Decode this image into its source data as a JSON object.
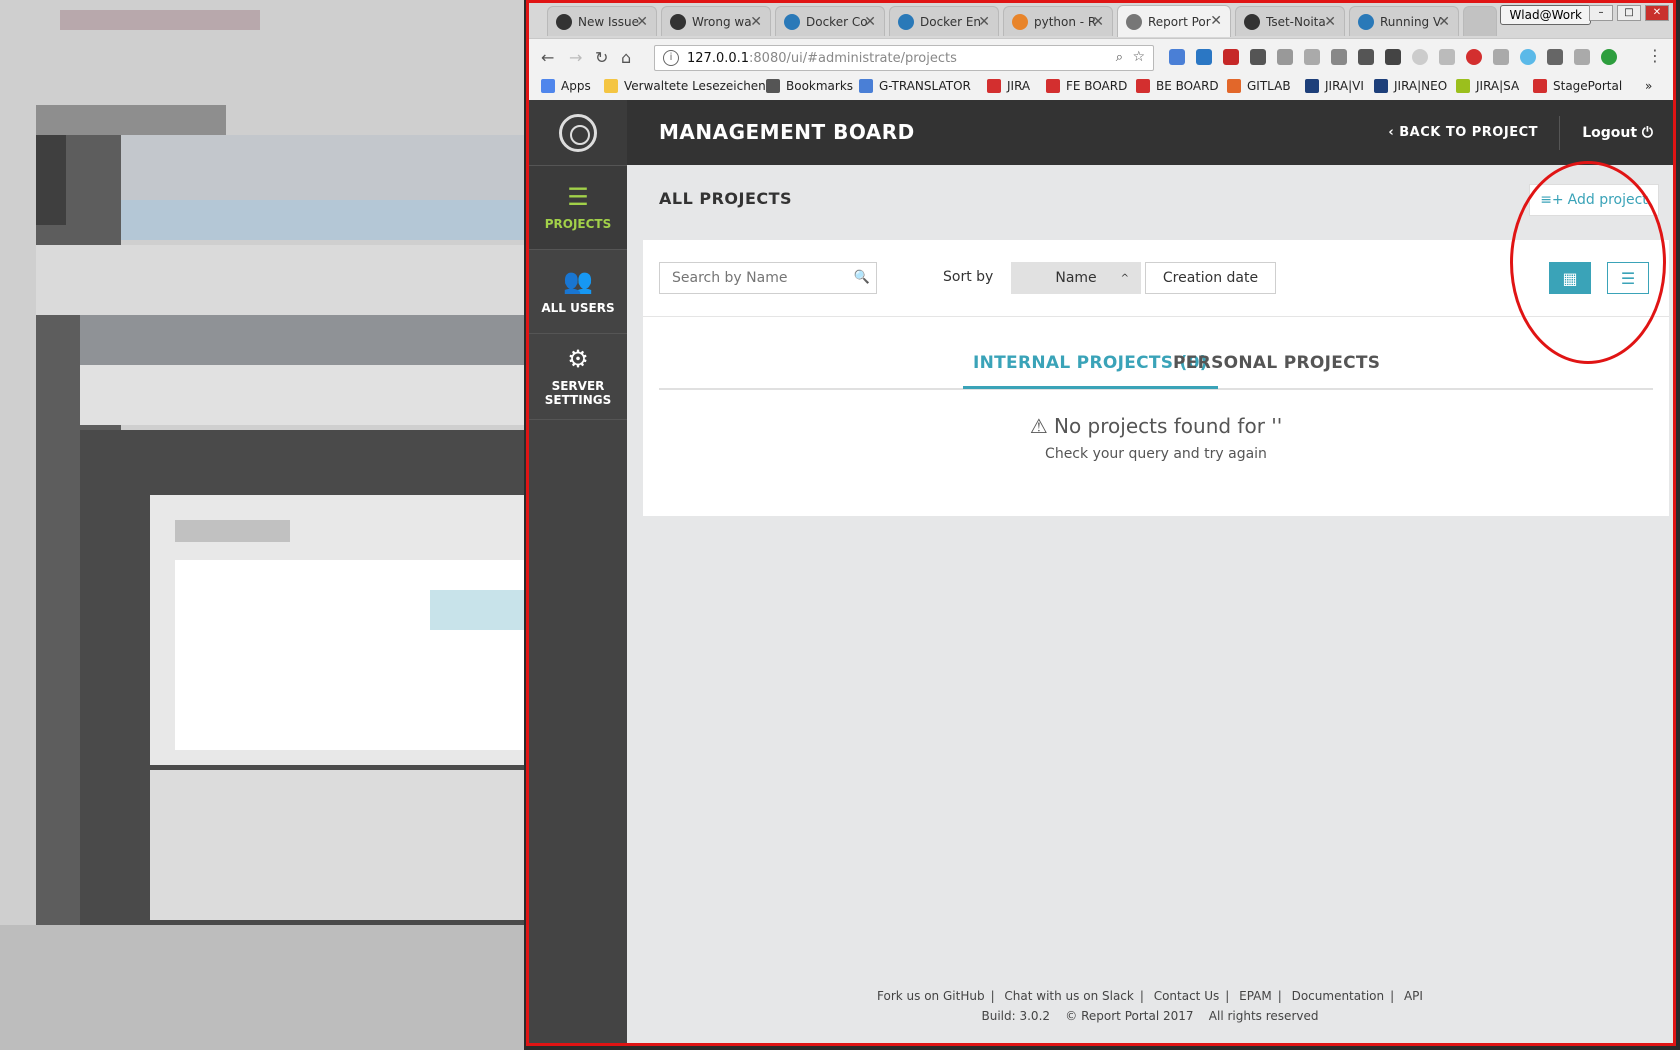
{
  "window": {
    "profile": "Wlad@Work",
    "tabs": [
      {
        "title": "New Issue"
      },
      {
        "title": "Wrong wa"
      },
      {
        "title": "Docker Co"
      },
      {
        "title": "Docker En"
      },
      {
        "title": "python - R"
      },
      {
        "title": "Report Por",
        "active": true
      },
      {
        "title": "Tset-Noita"
      },
      {
        "title": "Running V"
      }
    ]
  },
  "toolbar": {
    "url_host": "127.0.0.1",
    "url_rest": ":8080/ui/#administrate/projects"
  },
  "bookmarks": [
    "Apps",
    "Verwaltete Lesezeichen",
    "Bookmarks",
    "G-TRANSLATOR",
    "JIRA",
    "FE BOARD",
    "BE BOARD",
    "GITLAB",
    "JIRA|VI",
    "JIRA|NEO",
    "JIRA|SA",
    "StagePortal"
  ],
  "app": {
    "header_title": "MANAGEMENT BOARD",
    "back_label": "BACK TO PROJECT",
    "logout_label": "Logout",
    "sidebar": [
      {
        "label": "PROJECTS",
        "active": true
      },
      {
        "label": "ALL USERS"
      },
      {
        "label": "SERVER\nSETTINGS"
      }
    ],
    "page_title": "ALL PROJECTS",
    "add_project": "Add project",
    "search_placeholder": "Search by Name",
    "sort_by": "Sort by",
    "sort_name": "Name",
    "sort_date": "Creation date",
    "tabs": [
      "INTERNAL PROJECTS (0)",
      "PERSONAL PROJECTS"
    ],
    "empty_title": "No projects found for ''",
    "empty_sub": "Check your query and try again",
    "footer_links": [
      "Fork us on GitHub",
      "Chat with us on Slack",
      "Contact Us",
      "EPAM",
      "Documentation",
      "API"
    ],
    "build": "Build: 3.0.2",
    "copyright": "© Report Portal  2017",
    "rights": "All rights reserved"
  },
  "colors": {
    "accent": "#3aa3b8",
    "sidebar_active": "#a2d149",
    "annotation": "#e01414"
  }
}
